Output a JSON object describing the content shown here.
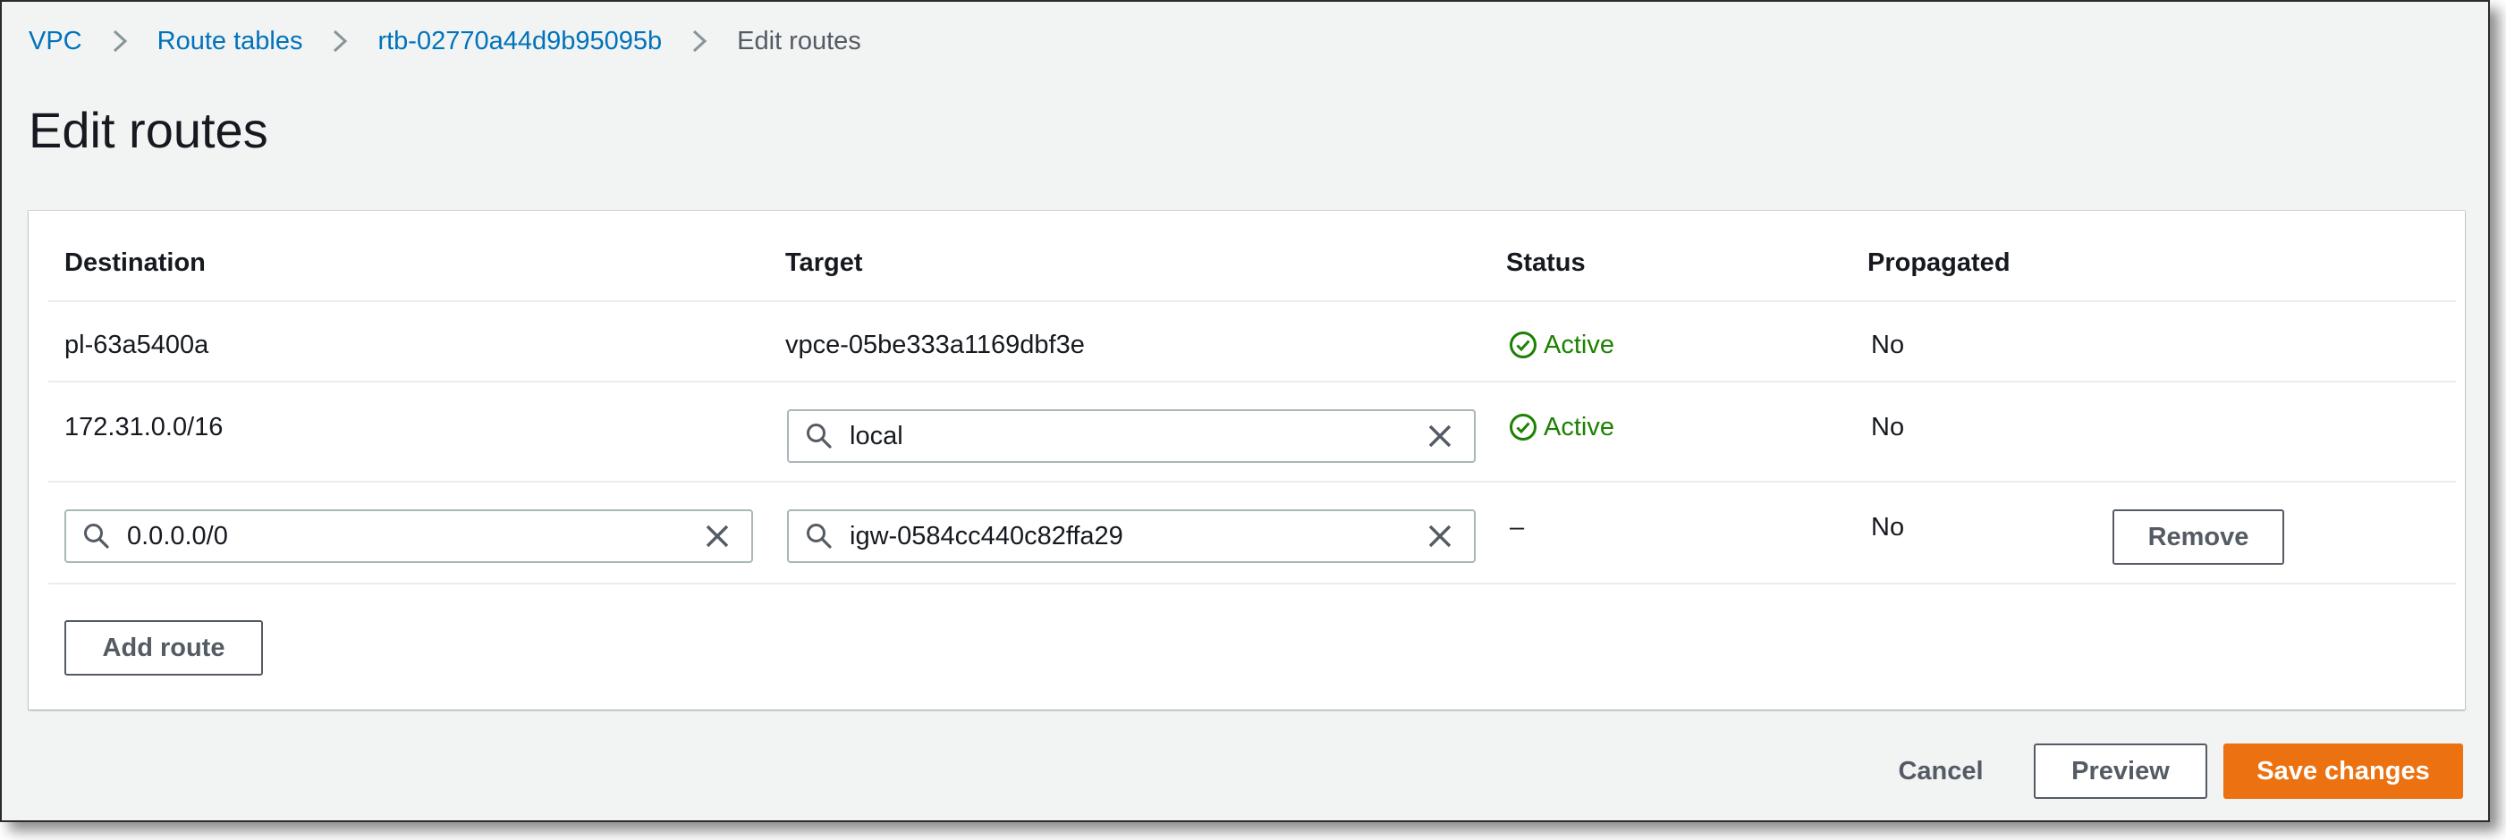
{
  "breadcrumb": {
    "items": [
      "VPC",
      "Route tables",
      "rtb-02770a44d9b95095b"
    ],
    "current": "Edit routes"
  },
  "page": {
    "title": "Edit routes"
  },
  "table": {
    "headers": {
      "destination": "Destination",
      "target": "Target",
      "status": "Status",
      "propagated": "Propagated"
    },
    "rows": [
      {
        "destination": "pl-63a5400a",
        "target": "vpce-05be333a1169dbf3e",
        "status": "Active",
        "propagated": "No"
      },
      {
        "destination": "172.31.0.0/16",
        "target": "local",
        "status": "Active",
        "propagated": "No"
      },
      {
        "destination": "0.0.0.0/0",
        "target": "igw-0584cc440c82ffa29",
        "status": "–",
        "propagated": "No",
        "remove_label": "Remove"
      }
    ],
    "add_route_label": "Add route"
  },
  "footer": {
    "cancel_label": "Cancel",
    "preview_label": "Preview",
    "save_label": "Save changes"
  },
  "icons": {
    "breadcrumb_separator": "chevron-right-icon",
    "status": "check-circle-icon",
    "input_search": "search-icon",
    "input_clear": "close-icon"
  },
  "colors": {
    "link": "#0073bb",
    "success": "#1d8102",
    "primary": "#ec7211",
    "background": "#f2f3f3"
  }
}
